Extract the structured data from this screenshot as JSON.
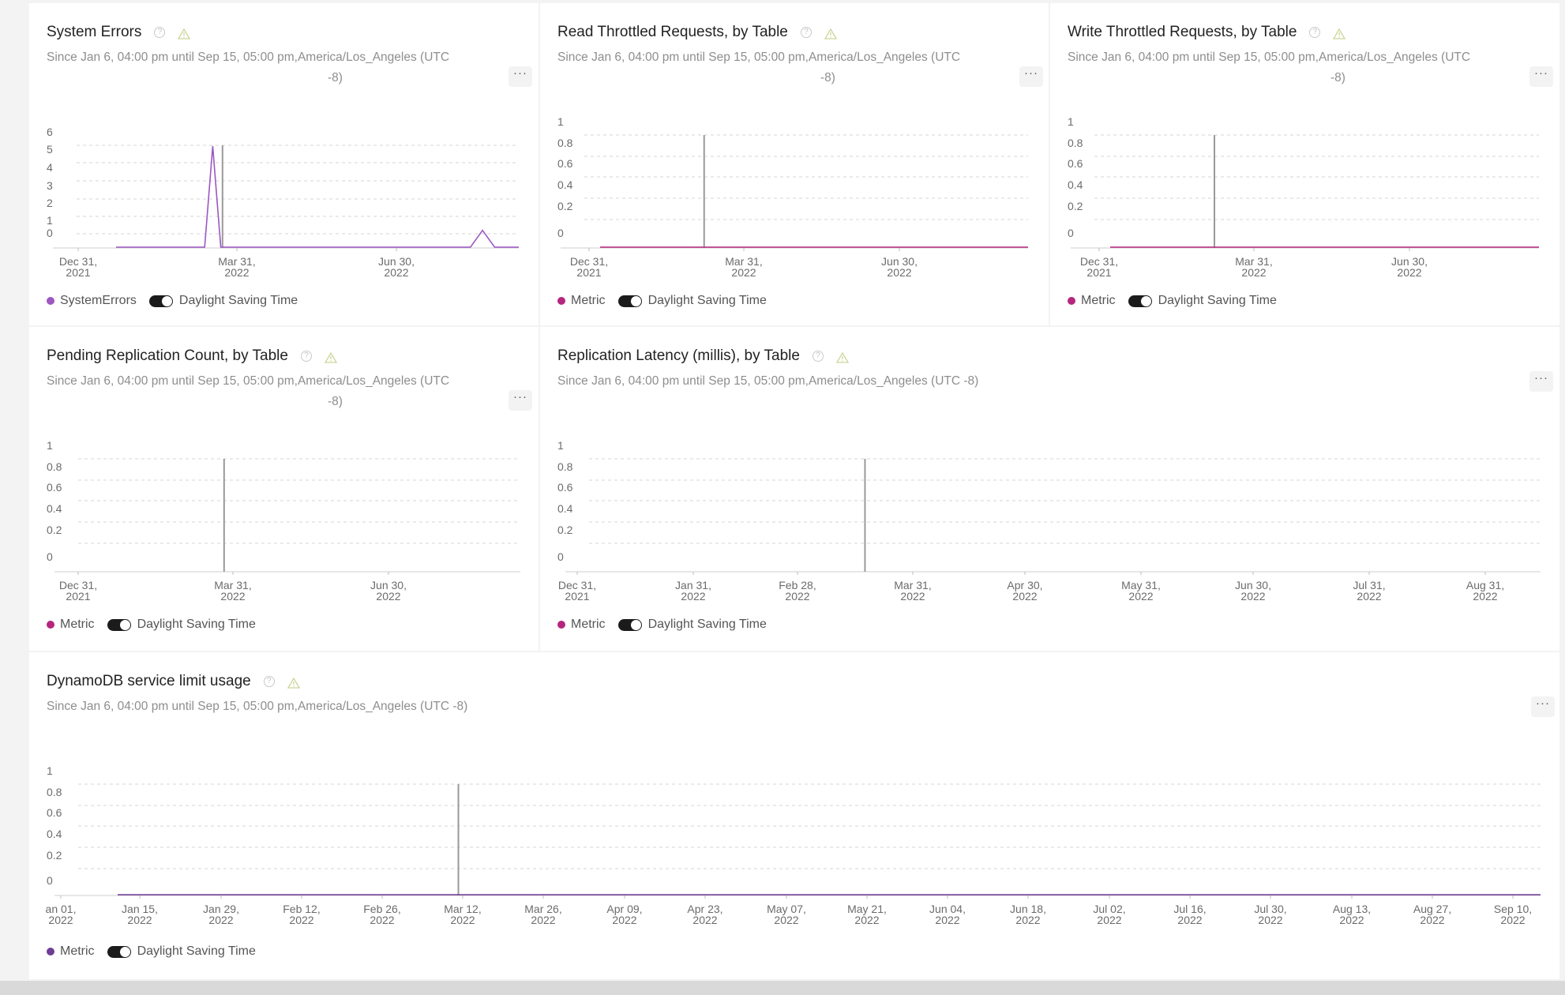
{
  "common": {
    "since": "Since Jan 6, 04:00 pm until Sep 15, 05:00 pm,America/Los_Angeles (UTC -8)",
    "since_wrap_a": "Since Jan 6, 04:00 pm until Sep 15, 05:00 pm,America/Los_Angeles (UTC",
    "since_wrap_b": "-8)",
    "more_label": "···",
    "dst_label": "Daylight Saving Time",
    "help_glyph": "?",
    "colors": {
      "magenta": "#b5267e",
      "violet": "#9b57c2",
      "purple": "#6f3d97",
      "event_line": "#9a9a9a",
      "grid": "#d6d6d6"
    }
  },
  "panels": [
    {
      "id": "system-errors",
      "title": "System Errors",
      "legend": "SystemErrors",
      "series_color": "#9b57c2",
      "chart_data": {
        "type": "line",
        "yticks": [
          "0",
          "1",
          "2",
          "3",
          "4",
          "5",
          "6"
        ],
        "ylim": [
          0,
          6
        ],
        "xticks": [
          [
            "Dec 31,",
            "2021"
          ],
          [
            "Mar 31,",
            "2022"
          ],
          [
            "Jun 30,",
            "2022"
          ]
        ],
        "series": [
          {
            "name": "SystemErrors",
            "points": [
              [
                0.0,
                0
              ],
              [
                0.22,
                0
              ],
              [
                0.24,
                6
              ],
              [
                0.26,
                0
              ],
              [
                0.88,
                0
              ],
              [
                0.91,
                1
              ],
              [
                0.94,
                0
              ],
              [
                1.0,
                0
              ]
            ]
          }
        ],
        "event_marker": 0.33
      }
    },
    {
      "id": "read-throttled",
      "title": "Read Throttled Requests, by Table",
      "legend": "Metric",
      "series_color": "#b5267e",
      "chart_data": {
        "type": "line",
        "yticks": [
          "0",
          "0.2",
          "0.4",
          "0.6",
          "0.8",
          "1"
        ],
        "ylim": [
          0,
          1
        ],
        "xticks": [
          [
            "Dec 31,",
            "2021"
          ],
          [
            "Mar 31,",
            "2022"
          ],
          [
            "Jun 30,",
            "2022"
          ]
        ],
        "series": [
          {
            "name": "Metric",
            "points": [
              [
                0,
                0
              ],
              [
                1,
                0
              ]
            ]
          }
        ],
        "event_marker": 0.27
      }
    },
    {
      "id": "write-throttled",
      "title": "Write Throttled Requests, by Table",
      "legend": "Metric",
      "series_color": "#b5267e",
      "chart_data": {
        "type": "line",
        "yticks": [
          "0",
          "0.2",
          "0.4",
          "0.6",
          "0.8",
          "1"
        ],
        "ylim": [
          0,
          1
        ],
        "xticks": [
          [
            "Dec 31,",
            "2021"
          ],
          [
            "Mar 31,",
            "2022"
          ],
          [
            "Jun 30,",
            "2022"
          ]
        ],
        "series": [
          {
            "name": "Metric",
            "points": [
              [
                0,
                0
              ],
              [
                1,
                0
              ]
            ]
          }
        ],
        "event_marker": 0.27
      }
    },
    {
      "id": "pending-replication",
      "title": "Pending Replication Count, by Table",
      "legend": "Metric",
      "series_color": "#b5267e",
      "chart_data": {
        "type": "line",
        "yticks": [
          "0",
          "0.2",
          "0.4",
          "0.6",
          "0.8",
          "1"
        ],
        "ylim": [
          0,
          1
        ],
        "xticks": [
          [
            "Dec 31,",
            "2021"
          ],
          [
            "Mar 31,",
            "2022"
          ],
          [
            "Jun 30,",
            "2022"
          ]
        ],
        "series": [],
        "event_marker": 0.33
      }
    },
    {
      "id": "replication-latency",
      "title": "Replication Latency (millis), by Table",
      "legend": "Metric",
      "series_color": "#b5267e",
      "chart_data": {
        "type": "line",
        "yticks": [
          "0",
          "0.2",
          "0.4",
          "0.6",
          "0.8",
          "1"
        ],
        "ylim": [
          0,
          1
        ],
        "xticks": [
          [
            "Dec 31,",
            "2021"
          ],
          [
            "Jan 31,",
            "2022"
          ],
          [
            "Feb 28,",
            "2022"
          ],
          [
            "Mar 31,",
            "2022"
          ],
          [
            "Apr 30,",
            "2022"
          ],
          [
            "May 31,",
            "2022"
          ],
          [
            "Jun 30,",
            "2022"
          ],
          [
            "Jul 31,",
            "2022"
          ],
          [
            "Aug 31,",
            "2022"
          ]
        ],
        "series": [],
        "event_marker": 0.29
      }
    },
    {
      "id": "service-limit",
      "title": "DynamoDB service limit usage",
      "legend": "Metric",
      "series_color": "#6f3d97",
      "chart_data": {
        "type": "line",
        "yticks": [
          "0",
          "0.2",
          "0.4",
          "0.6",
          "0.8",
          "1"
        ],
        "ylim": [
          0,
          1
        ],
        "xticks": [
          [
            "an 01,",
            "2022"
          ],
          [
            "Jan 15,",
            "2022"
          ],
          [
            "Jan 29,",
            "2022"
          ],
          [
            "Feb 12,",
            "2022"
          ],
          [
            "Feb 26,",
            "2022"
          ],
          [
            "Mar 12,",
            "2022"
          ],
          [
            "Mar 26,",
            "2022"
          ],
          [
            "Apr 09,",
            "2022"
          ],
          [
            "Apr 23,",
            "2022"
          ],
          [
            "May 07,",
            "2022"
          ],
          [
            "May 21,",
            "2022"
          ],
          [
            "Jun 04,",
            "2022"
          ],
          [
            "Jun 18,",
            "2022"
          ],
          [
            "Jul 02,",
            "2022"
          ],
          [
            "Jul 16,",
            "2022"
          ],
          [
            "Jul 30,",
            "2022"
          ],
          [
            "Aug 13,",
            "2022"
          ],
          [
            "Aug 27,",
            "2022"
          ],
          [
            "Sep 10,",
            "2022"
          ]
        ],
        "series": [
          {
            "name": "Metric",
            "points": [
              [
                0,
                0
              ],
              [
                1,
                0
              ]
            ]
          }
        ],
        "event_marker": 0.26
      }
    }
  ]
}
